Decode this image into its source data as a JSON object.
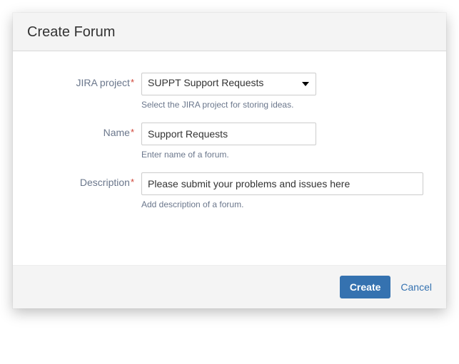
{
  "dialog": {
    "title": "Create Forum"
  },
  "fields": {
    "jira_project": {
      "label": "JIRA project",
      "selected": "SUPPT Support Requests",
      "help": "Select the JIRA project for storing ideas."
    },
    "name": {
      "label": "Name",
      "value": "Support Requests",
      "help": "Enter name of a forum."
    },
    "description": {
      "label": "Description",
      "value": "Please submit your problems and issues here",
      "help": "Add description of a forum."
    }
  },
  "buttons": {
    "create": "Create",
    "cancel": "Cancel"
  }
}
